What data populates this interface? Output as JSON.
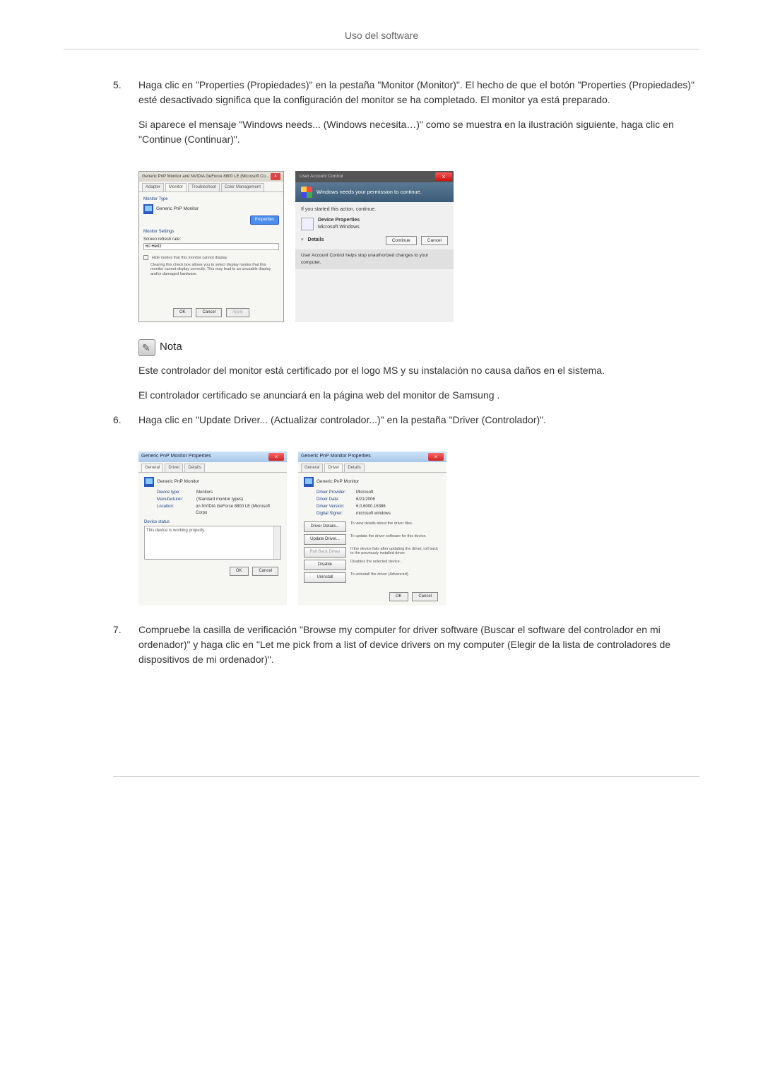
{
  "header": {
    "title": "Uso del software"
  },
  "step5": {
    "num": "5.",
    "p1": "Haga clic en \"Properties (Propiedades)\" en la pestaña \"Monitor (Monitor)\". El hecho de que el botón \"Properties (Propiedades)\" esté desactivado significa que la configuración del monitor se ha completado. El monitor ya está preparado.",
    "p2": "Si aparece el mensaje \"Windows needs... (Windows necesita…)\" como se muestra en la ilustración siguiente, haga clic en \"Continue (Continuar)\"."
  },
  "monitor_dlg": {
    "title": "Generic PnP Monitor and NVIDIA GeForce 8800 LE (Microsoft Co...",
    "tabs": {
      "adapter": "Adapter",
      "monitor": "Monitor",
      "troubleshoot": "Troubleshoot",
      "color": "Color Management"
    },
    "section_type": "Monitor Type",
    "device": "Generic PnP Monitor",
    "btn_properties": "Properties",
    "section_settings": "Monitor Settings",
    "refresh_label": "Screen refresh rate:",
    "refresh_value": "60 Hertz",
    "hide_modes": "Hide modes that this monitor cannot display",
    "hide_desc": "Clearing this check box allows you to select display modes that this monitor cannot display correctly. This may lead to an unusable display and/or damaged hardware.",
    "ok": "OK",
    "cancel": "Cancel",
    "apply": "Apply"
  },
  "uac": {
    "title": "User Account Control",
    "perm": "Windows needs your permission to continue.",
    "started": "If you started this action, continue.",
    "app_name": "Device Properties",
    "app_pub": "Microsoft Windows",
    "details": "Details",
    "continue": "Continue",
    "cancel": "Cancel",
    "footer": "User Account Control helps stop unauthorized changes to your computer."
  },
  "nota": {
    "label": "Nota",
    "p1": "Este controlador del monitor está certificado por el logo MS y su instalación no causa daños en el sistema.",
    "p2": "El controlador certificado se anunciará en la página web del monitor de Samsung ."
  },
  "step6": {
    "num": "6.",
    "p1": "Haga clic en \"Update Driver... (Actualizar controlador...)\" en la pestaña \"Driver (Controlador)\"."
  },
  "drv_left": {
    "title": "Generic PnP Monitor Properties",
    "tabs": {
      "general": "General",
      "driver": "Driver",
      "details": "Details"
    },
    "device": "Generic PnP Monitor",
    "k_type": "Device type:",
    "v_type": "Monitors",
    "k_mfr": "Manufacturer:",
    "v_mfr": "(Standard monitor types)",
    "k_loc": "Location:",
    "v_loc": "on NVIDIA GeForce 8800 LE (Microsoft Corpo",
    "status_label": "Device status",
    "status_text": "This device is working properly.",
    "ok": "OK",
    "cancel": "Cancel"
  },
  "drv_right": {
    "title": "Generic PnP Monitor Properties",
    "tabs": {
      "general": "General",
      "driver": "Driver",
      "details": "Details"
    },
    "device": "Generic PnP Monitor",
    "k_prov": "Driver Provider:",
    "v_prov": "Microsoft",
    "k_date": "Driver Date:",
    "v_date": "6/21/2006",
    "k_ver": "Driver Version:",
    "v_ver": "6.0.6000.16386",
    "k_sign": "Digital Signer:",
    "v_sign": "microsoft windows",
    "btn_details": "Driver Details...",
    "d_details": "To view details about the driver files.",
    "btn_update": "Update Driver...",
    "d_update": "To update the driver software for this device.",
    "btn_rollback": "Roll Back Driver",
    "d_rollback": "If the device fails after updating the driver, roll back to the previously installed driver.",
    "btn_disable": "Disable",
    "d_disable": "Disables the selected device.",
    "btn_uninstall": "Uninstall",
    "d_uninstall": "To uninstall the driver (Advanced).",
    "ok": "OK",
    "cancel": "Cancel"
  },
  "step7": {
    "num": "7.",
    "p1": "Compruebe la casilla de verificación \"Browse my computer for driver software (Buscar el software del controlador en mi ordenador)\" y haga clic en \"Let me pick from a list of device drivers on my computer (Elegir de la lista de controladores de dispositivos de mi ordenador)\"."
  }
}
